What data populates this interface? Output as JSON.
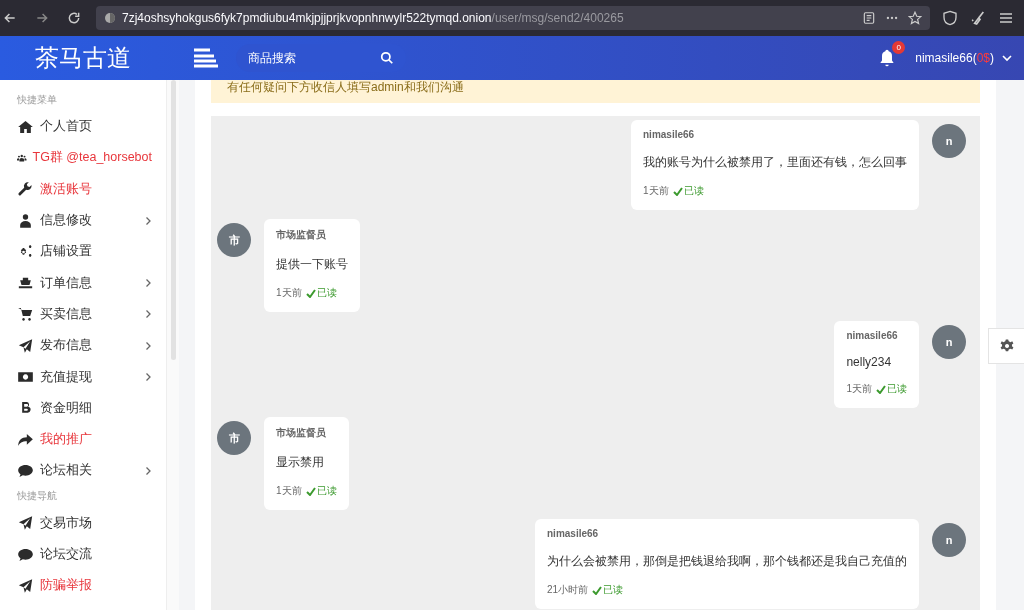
{
  "browser": {
    "host": "7zj4oshsyhokgus6fyk7pmdiubu4mkjpjjprjkvopnhnwylr522tymqd.onion",
    "path": "/user/msg/send2/400265"
  },
  "header": {
    "logo": "茶马古道",
    "search": {
      "placeholder": "商品搜索"
    },
    "notifications": "0",
    "account": {
      "name": "nimasile66(",
      "balance": "0$",
      "suffix": ")"
    }
  },
  "sidebar": {
    "items": [
      {
        "kind": "heading",
        "label": "快捷菜单"
      },
      {
        "kind": "link",
        "label": "个人首页",
        "color": "#333333",
        "submenu": false
      },
      {
        "kind": "link",
        "label": "TG群 @tea_horsebot",
        "color": "#e8363c",
        "submenu": false
      },
      {
        "kind": "link",
        "label": "激活账号",
        "color": "#e8363c",
        "submenu": false
      },
      {
        "kind": "link",
        "label": "信息修改",
        "color": "#333333",
        "submenu": true
      },
      {
        "kind": "link",
        "label": "店铺设置",
        "color": "#333333",
        "submenu": false
      },
      {
        "kind": "link",
        "label": "订单信息",
        "color": "#333333",
        "submenu": true
      },
      {
        "kind": "link",
        "label": "买卖信息",
        "color": "#333333",
        "submenu": true
      },
      {
        "kind": "link",
        "label": "发布信息",
        "color": "#333333",
        "submenu": true
      },
      {
        "kind": "link",
        "label": "充值提现",
        "color": "#333333",
        "submenu": true
      },
      {
        "kind": "link",
        "label": "资金明细",
        "color": "#333333",
        "submenu": false
      },
      {
        "kind": "link",
        "label": "我的推广",
        "color": "#e8363c",
        "submenu": false
      },
      {
        "kind": "link",
        "label": "论坛相关",
        "color": "#333333",
        "submenu": true
      },
      {
        "kind": "heading",
        "label": "快捷导航"
      },
      {
        "kind": "link",
        "label": "交易市场",
        "color": "#333333",
        "submenu": false
      },
      {
        "kind": "link",
        "label": "论坛交流",
        "color": "#333333",
        "submenu": false
      },
      {
        "kind": "link",
        "label": "防骗举报",
        "color": "#e8363c",
        "submenu": false
      }
    ]
  },
  "notice": "有任何疑问下方收信人填写admin和我们沟通",
  "messages": [
    {
      "kind": "sent",
      "avatar": "n",
      "sender": "nimasile66",
      "text": "我的账号为什么被禁用了，里面还有钱，怎么回事",
      "time": "1天前",
      "status": "已读",
      "read": true
    },
    {
      "kind": "received",
      "avatar": "市",
      "sender": "市场监督员",
      "text": "提供一下账号",
      "time": "1天前",
      "status": "已读",
      "read": true
    },
    {
      "kind": "sent",
      "avatar": "n",
      "sender": "nimasile66",
      "text": "nelly234",
      "time": "1天前",
      "status": "已读",
      "read": true
    },
    {
      "kind": "received",
      "avatar": "市",
      "sender": "市场监督员",
      "text": "显示禁用",
      "time": "1天前",
      "status": "已读",
      "read": true
    },
    {
      "kind": "sent",
      "avatar": "n",
      "sender": "nimasile66",
      "text": "为什么会被禁用，那倒是把钱退给我啊，那个钱都还是我自己充值的",
      "time": "21小时前",
      "status": "已读",
      "read": true
    }
  ]
}
